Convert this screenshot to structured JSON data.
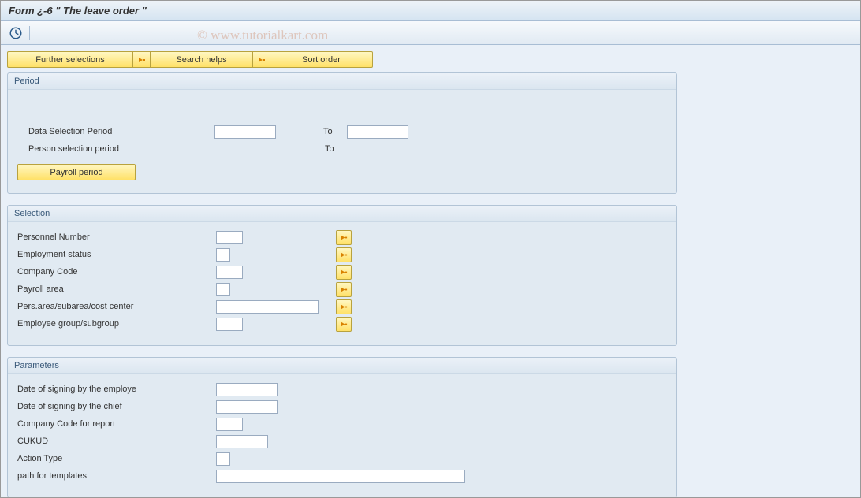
{
  "title": "Form ¿-6 \" The leave order \"",
  "watermark": "© www.tutorialkart.com",
  "top_buttons": {
    "further_selections": "Further selections",
    "search_helps": "Search helps",
    "sort_order": "Sort order"
  },
  "groups": {
    "period": {
      "title": "Period",
      "rows": {
        "data_selection": {
          "label": "Data Selection Period",
          "from": "",
          "to_label": "To",
          "to": ""
        },
        "person_selection": {
          "label": "Person selection period",
          "to_label": "To"
        }
      },
      "payroll_btn": "Payroll period"
    },
    "selection": {
      "title": "Selection",
      "rows": {
        "personnel_number": {
          "label": "Personnel Number",
          "value": ""
        },
        "employment_status": {
          "label": "Employment status",
          "value": ""
        },
        "company_code": {
          "label": "Company Code",
          "value": ""
        },
        "payroll_area": {
          "label": "Payroll area",
          "value": ""
        },
        "pers_area": {
          "label": "Pers.area/subarea/cost center",
          "value": ""
        },
        "employee_group": {
          "label": "Employee group/subgroup",
          "value": ""
        }
      }
    },
    "parameters": {
      "title": "Parameters",
      "rows": {
        "date_employee": {
          "label": "Date of signing by the employe",
          "value": ""
        },
        "date_chief": {
          "label": "Date of signing by the chief",
          "value": ""
        },
        "company_code_report": {
          "label": "Company Code for report",
          "value": ""
        },
        "cukud": {
          "label": "CUKUD",
          "value": ""
        },
        "action_type": {
          "label": "Action Type",
          "value": ""
        },
        "path_templates": {
          "label": "path for templates",
          "value": ""
        }
      }
    }
  }
}
